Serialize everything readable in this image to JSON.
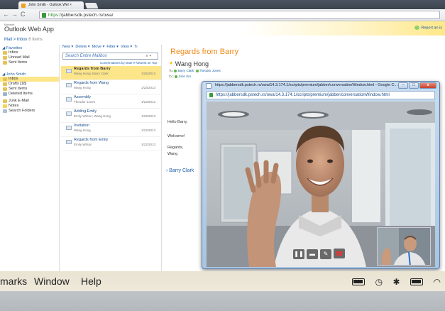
{
  "browser": {
    "tab_title": "John Smith - Outlook Wel ×",
    "tab_close": "×",
    "url_https": "https",
    "url_rest": "://jabbersdk.pstech.rs/owa/"
  },
  "owa": {
    "brand_small": "Microsoft",
    "logo": "Outlook Web App",
    "report_link": "Report an is",
    "breadcrumb": "Mail > Inbox",
    "breadcrumb_count": "6 Items",
    "folders": {
      "favorites_label": "◢ Favorites",
      "favorites": [
        "Inbox",
        "Unread Mail",
        "Sent Items"
      ],
      "account_label": "◢ John Smith",
      "account_folders": [
        "Inbox",
        "Drafts [18]",
        "Sent Items",
        "Deleted Items",
        "Junk E-Mail",
        "Notes",
        "Search Folders"
      ]
    },
    "toolbar": {
      "new": "New ▾",
      "delete": "Delete ▾",
      "move": "Move ▾",
      "filter": "Filter ▾",
      "view": "View ▾",
      "refresh_icon": "↻"
    },
    "search": {
      "placeholder": "Search Entire Mailbox",
      "mag": "⌕ ▾"
    },
    "conversations_label": "Conversations by Date ▾  Newest on Top",
    "messages": [
      {
        "subject": "Regards from Barry",
        "from": "Wang Hong; Barry Clark",
        "date": "1/25/2013"
      },
      {
        "subject": "Regards from Wang",
        "from": "Wang Hong",
        "date": "1/23/2013"
      },
      {
        "subject": "Assembly",
        "from": "Theodor Jones",
        "date": "1/23/2013"
      },
      {
        "subject": "Adding Emily",
        "from": "Emily Wilson; Wang Hong",
        "date": "1/23/2013"
      },
      {
        "subject": "Invitation",
        "from": "Wang Hong",
        "date": "1/23/2013"
      },
      {
        "subject": "Regards from Emily",
        "from": "Emily Wilson",
        "date": "1/22/2013"
      }
    ],
    "reading": {
      "title": "Regards from Barry",
      "star": "★",
      "sender": "Wang Hong",
      "to_label": "To:",
      "to_1": "Barry Clark",
      "to_2": "Theodor Jones",
      "cc_label": "Cc:",
      "cc_1": "John Sm",
      "greeting": "Hello Barry,",
      "welcome": "Welcome!",
      "regards": "Regards,",
      "signature": "Wang",
      "thread": "› Barry Clark"
    }
  },
  "video_window": {
    "title": "https://jabbersdk.pstech.rs/owa/14.3.174.1/scripts/premium/jabber/conversationWindow.html - Google C...",
    "url": "https://jabbersdk.pstech.rs/owa/14.3.174.1/scripts/premium/jabber/conversationWindow.html",
    "minimize": "–",
    "maximize": "□",
    "close": "x",
    "controls": {
      "pause": "❚❚",
      "video_off": "▬",
      "mute": "✎",
      "end_call": "☎"
    }
  },
  "os_menubar": {
    "items": [
      "marks",
      "Window",
      "Help"
    ],
    "tray_clock": "◷",
    "tray_bluetooth": "✱",
    "tray_wifi": "◠"
  }
}
